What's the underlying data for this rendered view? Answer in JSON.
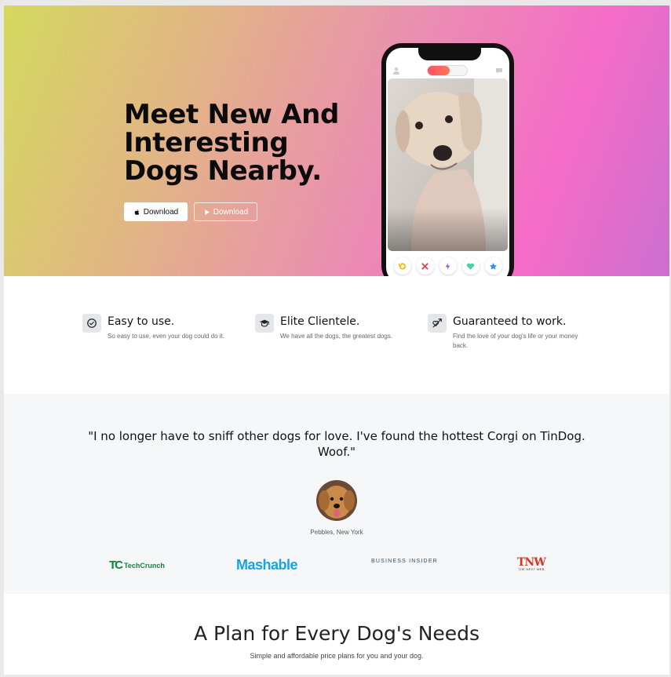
{
  "hero": {
    "title": "Meet New And Interesting Dogs Nearby.",
    "download_apple_label": "Download",
    "download_play_label": "Download",
    "apple_icon": "apple-icon",
    "play_icon": "play-icon",
    "gradient_colors": [
      "#d4d95e",
      "#e2b486",
      "#ea8fb0",
      "#f56cc8",
      "#cc6fcf"
    ]
  },
  "phone": {
    "actions": [
      "undo-icon",
      "close-icon",
      "lightning-icon",
      "heart-icon",
      "star-icon"
    ]
  },
  "features": [
    {
      "icon": "check-circle-icon",
      "title": "Easy to use.",
      "text": "So easy to use, even your dog could do it."
    },
    {
      "icon": "graduation-cap-icon",
      "title": "Elite Clientele.",
      "text": "We have all the dogs, the greatest dogs."
    },
    {
      "icon": "heart-arrow-icon",
      "title": "Guaranteed to work.",
      "text": "Find the love of your dog's life or your money back."
    }
  ],
  "testimonial": {
    "quote": "\"I no longer have to sniff other dogs for love. I've found the hottest Corgi on TinDog. Woof.\"",
    "author": "Pebbles, New York"
  },
  "press": {
    "techcrunch_mark": "TC",
    "techcrunch": "TechCrunch",
    "mashable": "Mashable",
    "business_insider": "BUSINESS INSIDER",
    "tnw": "TNW",
    "tnw_small": "THE NEXT WEB"
  },
  "pricing": {
    "title": "A Plan for Every Dog's Needs",
    "subtitle": "Simple and affordable price plans for you and your dog."
  }
}
